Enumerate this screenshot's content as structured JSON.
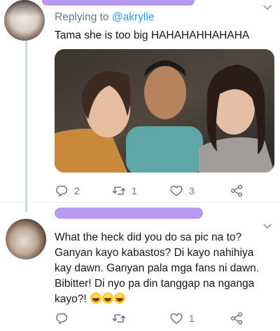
{
  "reply_tweet": {
    "replying_prefix": "Replying to ",
    "replying_handle": "@akrylle",
    "text": "Tama she is too big HAHAHAHHAHAHA",
    "counts": {
      "replies": "2",
      "retweets": "1",
      "likes": "3"
    }
  },
  "second_tweet": {
    "text": "What the heck did you do sa pic na to?\nGanyan kayo kabastos? Di kayo nahihiya kay dawn. Ganyan pala mga fans ni dawn. Bibitter! Di nyo pa din tanggap na nganga kayo?! ",
    "emoji": [
      "grinning-face-with-sweat",
      "grinning-face-with-sweat",
      "grinning-face-with-sweat"
    ],
    "counts": {
      "replies": "",
      "retweets": "",
      "likes": "1"
    }
  },
  "colors": {
    "link": "#1da1f2",
    "muted": "#657786",
    "redaction": "#b79af0"
  }
}
